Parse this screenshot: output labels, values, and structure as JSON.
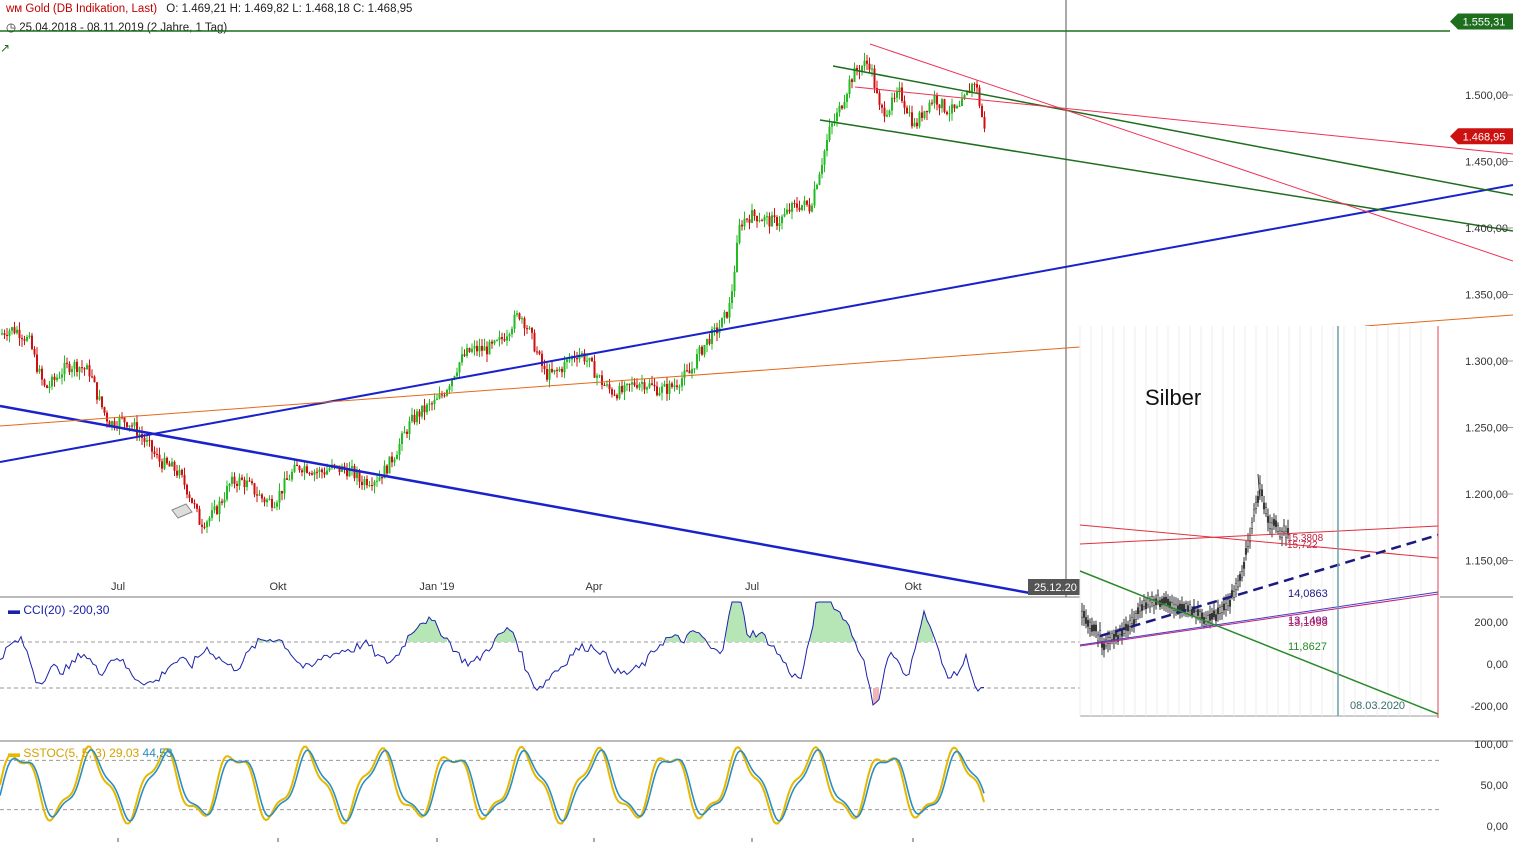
{
  "header": {
    "instrument": "Gold (DB Indikation, Last)",
    "ohlc": "O: 1.469,21  H: 1.469,82  L: 1.468,18  C: 1.468,95",
    "range": "25.04.2018 - 08.11.2019  (2 Jahre, 1 Tag)"
  },
  "cci": {
    "label": "CCI(20)",
    "value": "-200,30"
  },
  "sstoc": {
    "label": "SSTOC(5, 5, 3)",
    "value1": "29,03",
    "value2": "44,53"
  },
  "colors": {
    "up": "#22bb22",
    "down": "#cc1111",
    "trend_blue": "#1a22cc",
    "trend_green": "#1e6e1e",
    "trend_red": "#ee3355",
    "trend_orange": "#e26a1a"
  },
  "chart_data": [
    {
      "type": "candlestick",
      "title": "Gold (DB Indikation, Last)",
      "x_ticks": [
        "Jul",
        "Okt",
        "Jan '19",
        "Apr",
        "Jul",
        "Okt"
      ],
      "y_ticks": [
        "1.500,00",
        "1.450,00",
        "1.400,00",
        "1.350,00",
        "1.300,00",
        "1.250,00",
        "1.200,00",
        "1.150,00"
      ],
      "ylim": [
        1135,
        1565
      ],
      "price_tags": [
        {
          "text": "1.555,31",
          "value": 1555.31,
          "color": "#1e6e1e"
        },
        {
          "text": "1.468,95",
          "value": 1468.95,
          "color": "#cc1111"
        }
      ],
      "time_marker": "25.12.20",
      "closes_approx": [
        {
          "month": "Apr 2018",
          "value": 1320
        },
        {
          "month": "Jun 2018",
          "value": 1255
        },
        {
          "month": "Aug 2018",
          "value": 1185
        },
        {
          "month": "Okt 2018",
          "value": 1215
        },
        {
          "month": "Jan 2019",
          "value": 1290
        },
        {
          "month": "Feb 2019",
          "value": 1340
        },
        {
          "month": "Apr 2019",
          "value": 1280
        },
        {
          "month": "Jun 2019",
          "value": 1345
        },
        {
          "month": "Jul 2019",
          "value": 1420
        },
        {
          "month": "Aug 2019",
          "value": 1510
        },
        {
          "month": "Sep 2019",
          "value": 1500
        },
        {
          "month": "Nov 2019",
          "value": 1468.95
        }
      ]
    },
    {
      "type": "line",
      "title": "CCI(20)",
      "y_ticks": [
        "200,00",
        "0,00",
        "-200,00"
      ],
      "ylim": [
        -250,
        250
      ],
      "last_value": -200.3
    },
    {
      "type": "line",
      "title": "SSTOC(5, 5, 3)",
      "y_ticks": [
        "100,00",
        "50,00",
        "0,00"
      ],
      "ylim": [
        -10,
        110
      ],
      "series": [
        {
          "name": "29,03",
          "last_value": 29.03,
          "color": "#e6b800"
        },
        {
          "name": "44,53",
          "last_value": 44.53,
          "color": "#2a8fc0"
        }
      ]
    },
    {
      "type": "candlestick",
      "title": "Silber",
      "annotations": [
        "15,3808",
        "15,722",
        "14,0863",
        "13,1498",
        "13,1093",
        "11,8627",
        "08.03.2020"
      ]
    }
  ]
}
